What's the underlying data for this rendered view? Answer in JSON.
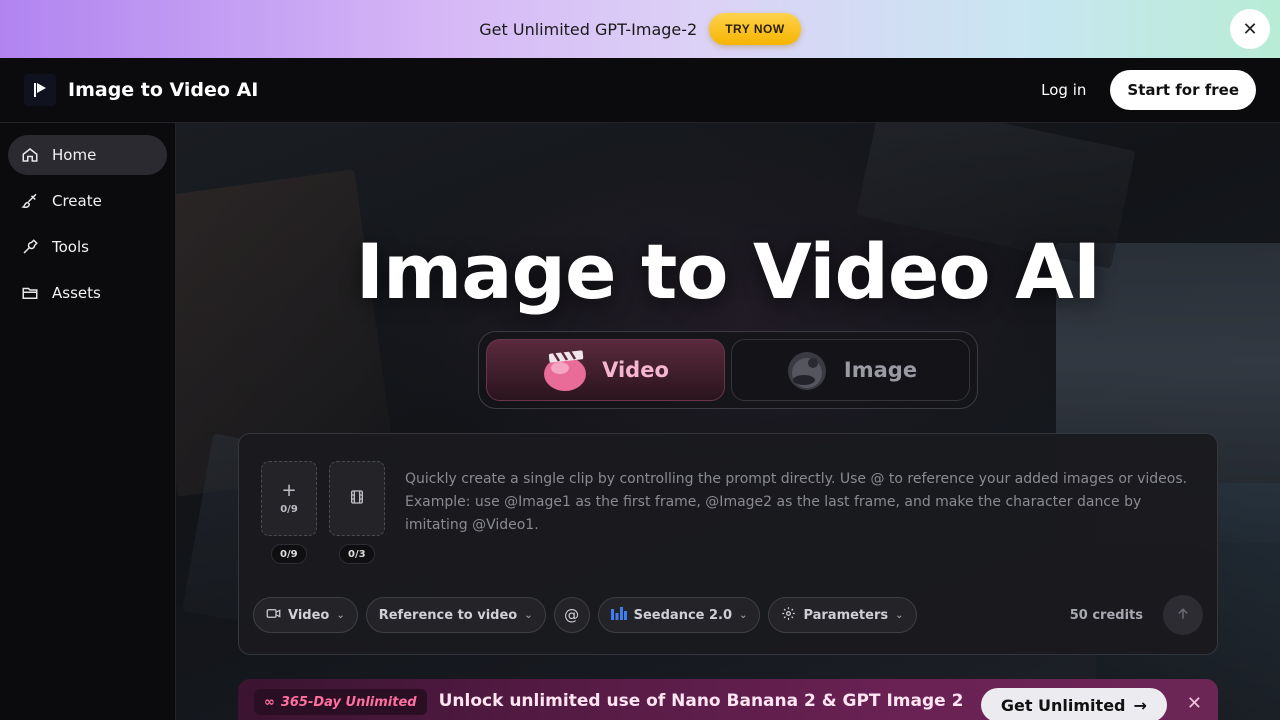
{
  "promo": {
    "text": "Get Unlimited GPT-Image-2",
    "button": "TRY NOW",
    "close": "✕"
  },
  "header": {
    "brand": "Image to Video AI",
    "login": "Log in",
    "start": "Start for free"
  },
  "sidebar": {
    "items": [
      {
        "label": "Home",
        "icon": "home-icon",
        "active": true
      },
      {
        "label": "Create",
        "icon": "brush-icon",
        "active": false
      },
      {
        "label": "Tools",
        "icon": "wrench-icon",
        "active": false
      },
      {
        "label": "Assets",
        "icon": "folder-icon",
        "active": false
      }
    ]
  },
  "hero": {
    "title": "Image to Video AI"
  },
  "modes": {
    "video": "Video",
    "image": "Image",
    "selected": "Video"
  },
  "prompt": {
    "slot_image_count": "0/9",
    "slot_image_badge": "0/9",
    "slot_video_badge": "0/3",
    "placeholder": "Quickly create a single clip by controlling the prompt directly. Use @ to reference your added images or videos. Example: use @Image1 as the first frame, @Image2 as the last frame, and make the character dance by imitating @Video1."
  },
  "toolbar": {
    "type": "Video",
    "mode": "Reference to video",
    "mention": "@",
    "model": "Seedance 2.0",
    "params": "Parameters",
    "credits": "50 credits"
  },
  "banner": {
    "tag": "365-Day Unlimited",
    "text": "Unlock unlimited use of Nano Banana 2 & GPT Image 2",
    "button": "Get Unlimited",
    "close": "✕"
  },
  "colors": {
    "accent_pink": "#f7b6cf",
    "promo_yellow": "#f5b400",
    "banner_tag": "#ff6fa0"
  }
}
